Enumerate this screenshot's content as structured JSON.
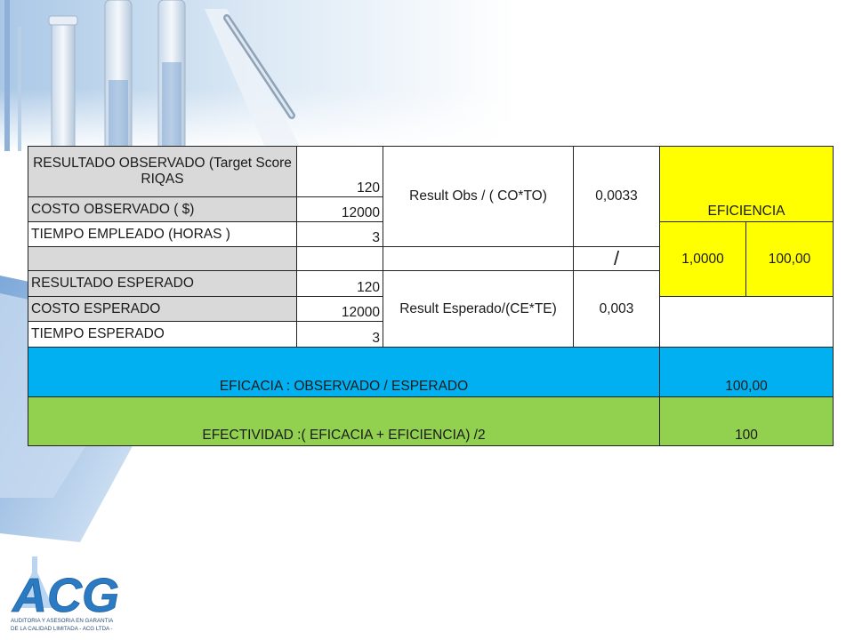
{
  "table": {
    "rows": {
      "resultado_observado": {
        "label": "RESULTADO OBSERVADO  (Target Score RIQAS",
        "value": "120"
      },
      "costo_observado": {
        "label": "COSTO  OBSERVADO  ( $)",
        "value": "12000"
      },
      "tiempo_empleado": {
        "label": "TIEMPO EMPLEADO  (HORAS )",
        "value": "3"
      },
      "resultado_esperado": {
        "label": "RESULTADO ESPERADO",
        "value": "120"
      },
      "costo_esperado": {
        "label": "COSTO ESPERADO",
        "value": "12000"
      },
      "tiempo_esperado": {
        "label": "TIEMPO ESPERADO",
        "value": "3"
      }
    },
    "formula_obs": {
      "label": "Result  Obs / ( CO*TO)",
      "value": "0,0033"
    },
    "divider": "/",
    "formula_esp": {
      "label": "Result Esperado/(CE*TE)",
      "value": "0,003"
    },
    "eficiencia": {
      "label": "EFICIENCIA",
      "ratio": "1,0000",
      "percent": "100,00"
    },
    "eficacia": {
      "label": "EFICACIA : OBSERVADO / ESPERADO",
      "value": "100,00"
    },
    "efectividad": {
      "label": "EFECTIVIDAD :( EFICACIA + EFICIENCIA) /2",
      "value": "100"
    }
  },
  "logo": {
    "text": "ACG",
    "tagline_1": "AUDITORIA Y ASESORIA EN GARANTIA",
    "tagline_2": "DE LA CALIDAD LIMITADA - ACG LTDA -"
  },
  "colors": {
    "yellow": "#ffff00",
    "blue": "#00b0f0",
    "green": "#92d050",
    "gray": "#d9d9d9"
  }
}
